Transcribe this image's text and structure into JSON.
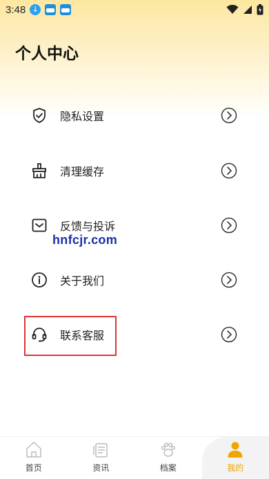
{
  "status_bar": {
    "time": "3:48",
    "icons": [
      "download-icon",
      "app-notification-icon",
      "app-notification-icon",
      "wifi-icon",
      "signal-icon",
      "battery-icon"
    ]
  },
  "page_title": "个人中心",
  "menu": {
    "items": [
      {
        "label": "隐私设置",
        "icon": "shield-icon"
      },
      {
        "label": "清理缓存",
        "icon": "broom-icon"
      },
      {
        "label": "反馈与投诉",
        "icon": "feedback-icon"
      },
      {
        "label": "关于我们",
        "icon": "info-icon"
      },
      {
        "label": "联系客服",
        "icon": "headset-icon"
      }
    ]
  },
  "watermark": "hnfcjr.com",
  "tabs": [
    {
      "label": "首页",
      "icon": "home-icon"
    },
    {
      "label": "资讯",
      "icon": "news-icon"
    },
    {
      "label": "档案",
      "icon": "paw-icon"
    },
    {
      "label": "我的",
      "icon": "user-icon"
    }
  ],
  "colors": {
    "accent": "#f0a500",
    "highlight": "#dd3333",
    "watermark": "#1a2fa8"
  }
}
